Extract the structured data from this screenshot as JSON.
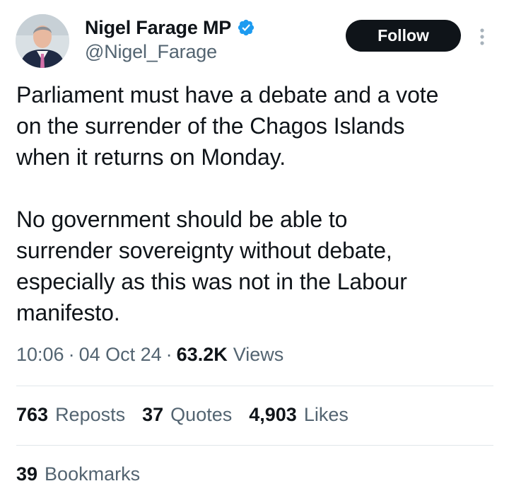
{
  "author": {
    "display_name": "Nigel Farage MP",
    "handle": "@Nigel_Farage",
    "verified": true
  },
  "actions": {
    "follow_label": "Follow"
  },
  "tweet": {
    "text": "Parliament must have a debate and a vote\non the surrender of the Chagos Islands\nwhen it returns on Monday.\n\nNo government should be able to\nsurrender sovereignty without debate,\nespecially as this was not in the Labour\nmanifesto."
  },
  "meta": {
    "time": "10:06",
    "separator": "·",
    "date": "04 Oct 24",
    "views_count": "63.2K",
    "views_label": "Views"
  },
  "stats": {
    "reposts": {
      "count": "763",
      "label": "Reposts"
    },
    "quotes": {
      "count": "37",
      "label": "Quotes"
    },
    "likes": {
      "count": "4,903",
      "label": "Likes"
    },
    "bookmarks": {
      "count": "39",
      "label": "Bookmarks"
    }
  },
  "colors": {
    "text_primary": "#0f1419",
    "text_secondary": "#536471",
    "verified_blue": "#1d9bf0",
    "follow_bg": "#0f1419",
    "divider": "#e1e6ea"
  },
  "icons": {
    "verified": "verified-badge-icon",
    "more": "more-vertical-icon"
  }
}
